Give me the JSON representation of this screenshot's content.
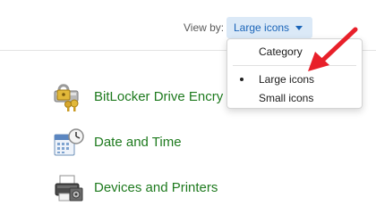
{
  "view_by": {
    "label": "View by:",
    "value": "Large icons",
    "options": [
      {
        "label": "Category",
        "selected": false
      },
      {
        "label": "Large icons",
        "selected": true
      },
      {
        "label": "Small icons",
        "selected": false
      }
    ]
  },
  "items": [
    {
      "label": "BitLocker Drive Encry",
      "icon": "bitlocker-icon"
    },
    {
      "label": "Date and Time",
      "icon": "calendar-clock-icon"
    },
    {
      "label": "Devices and Printers",
      "icon": "printer-icon"
    }
  ],
  "colors": {
    "link": "#1e7a1e",
    "accent": "#1a64b8",
    "annotation": "#e8202a"
  }
}
